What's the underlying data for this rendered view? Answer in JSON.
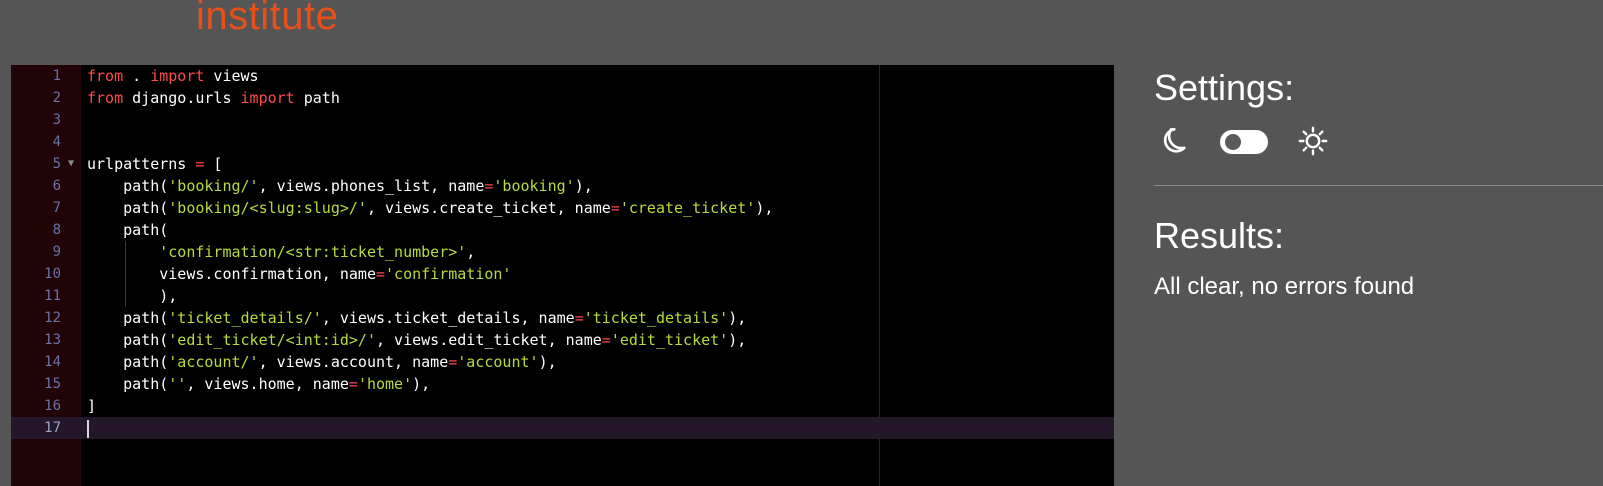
{
  "brand": {
    "text": "institute"
  },
  "editor": {
    "lines": [
      {
        "number": "1",
        "tokens": [
          [
            "kw",
            "from"
          ],
          [
            "plain",
            " . "
          ],
          [
            "kw",
            "import"
          ],
          [
            "plain",
            " views"
          ]
        ]
      },
      {
        "number": "2",
        "tokens": [
          [
            "kw",
            "from"
          ],
          [
            "plain",
            " django.urls "
          ],
          [
            "kw",
            "import"
          ],
          [
            "plain",
            " path"
          ]
        ]
      },
      {
        "number": "3",
        "tokens": []
      },
      {
        "number": "4",
        "tokens": []
      },
      {
        "number": "5",
        "fold": true,
        "tokens": [
          [
            "plain",
            "urlpatterns "
          ],
          [
            "op",
            "="
          ],
          [
            "plain",
            " ["
          ]
        ]
      },
      {
        "number": "6",
        "tokens": [
          [
            "plain",
            "    path("
          ],
          [
            "str",
            "'booking/'"
          ],
          [
            "plain",
            ", views.phones_list, name"
          ],
          [
            "op",
            "="
          ],
          [
            "str",
            "'booking'"
          ],
          [
            "plain",
            "),"
          ]
        ]
      },
      {
        "number": "7",
        "tokens": [
          [
            "plain",
            "    path("
          ],
          [
            "str",
            "'booking/<slug:slug>/'"
          ],
          [
            "plain",
            ", views.create_ticket, name"
          ],
          [
            "op",
            "="
          ],
          [
            "str",
            "'create_ticket'"
          ],
          [
            "plain",
            "),"
          ]
        ]
      },
      {
        "number": "8",
        "tokens": [
          [
            "plain",
            "    path("
          ]
        ]
      },
      {
        "number": "9",
        "tokens": [
          [
            "plain",
            "        "
          ],
          [
            "str",
            "'confirmation/<str:ticket_number>'"
          ],
          [
            "plain",
            ","
          ]
        ]
      },
      {
        "number": "10",
        "tokens": [
          [
            "plain",
            "        views.confirmation, name"
          ],
          [
            "op",
            "="
          ],
          [
            "str",
            "'confirmation'"
          ]
        ]
      },
      {
        "number": "11",
        "tokens": [
          [
            "plain",
            "        ),"
          ]
        ]
      },
      {
        "number": "12",
        "tokens": [
          [
            "plain",
            "    path("
          ],
          [
            "str",
            "'ticket_details/'"
          ],
          [
            "plain",
            ", views.ticket_details, name"
          ],
          [
            "op",
            "="
          ],
          [
            "str",
            "'ticket_details'"
          ],
          [
            "plain",
            "),"
          ]
        ]
      },
      {
        "number": "13",
        "tokens": [
          [
            "plain",
            "    path("
          ],
          [
            "str",
            "'edit_ticket/<int:id>/'"
          ],
          [
            "plain",
            ", views.edit_ticket, name"
          ],
          [
            "op",
            "="
          ],
          [
            "str",
            "'edit_ticket'"
          ],
          [
            "plain",
            "),"
          ]
        ]
      },
      {
        "number": "14",
        "tokens": [
          [
            "plain",
            "    path("
          ],
          [
            "str",
            "'account/'"
          ],
          [
            "plain",
            ", views.account, name"
          ],
          [
            "op",
            "="
          ],
          [
            "str",
            "'account'"
          ],
          [
            "plain",
            "),"
          ]
        ]
      },
      {
        "number": "15",
        "tokens": [
          [
            "plain",
            "    path("
          ],
          [
            "str",
            "''"
          ],
          [
            "plain",
            ", views.home, name"
          ],
          [
            "op",
            "="
          ],
          [
            "str",
            "'home'"
          ],
          [
            "plain",
            "),"
          ]
        ]
      },
      {
        "number": "16",
        "tokens": [
          [
            "plain",
            "]"
          ]
        ]
      },
      {
        "number": "17",
        "active": true,
        "cursor": true,
        "tokens": []
      }
    ],
    "colors": {
      "keyword": "#ff4a4a",
      "string": "#b9db3a",
      "text": "#ffffff",
      "background": "#000000",
      "gutter": "#200407"
    }
  },
  "settings": {
    "title": "Settings:",
    "theme_toggle": {
      "left_icon": "moon-icon",
      "right_icon": "sun-icon",
      "checked": false
    }
  },
  "results": {
    "title": "Results:",
    "message": "All clear, no errors found"
  }
}
